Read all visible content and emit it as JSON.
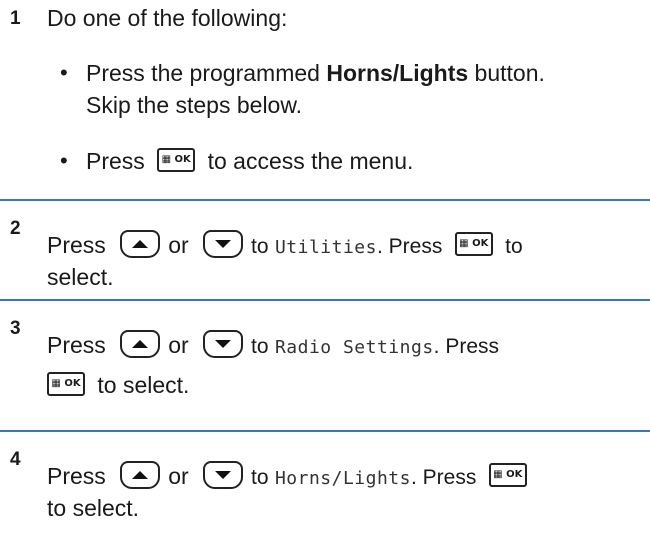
{
  "steps": [
    {
      "number": "1",
      "intro": "Do one of the following:",
      "bullets": [
        {
          "line1_pre": "Press the programmed ",
          "line1_bold": "Horns/Lights",
          "line1_post": " button.",
          "line2": "Skip the steps below."
        },
        {
          "pre": "Press",
          "key": "OK",
          "post": "to access the menu."
        }
      ]
    },
    {
      "number": "2",
      "pre": "Press",
      "or": "or",
      "to": "to",
      "target": "Utilities",
      "press_after": ". Press",
      "key": "OK",
      "end_same_line": "to",
      "line2": "select."
    },
    {
      "number": "3",
      "pre": "Press",
      "or": "or",
      "to": "to",
      "target": "Radio Settings",
      "press_after": ". Press",
      "key": "OK",
      "line2_post": "to select."
    },
    {
      "number": "4",
      "pre": "Press",
      "or": "or",
      "to": "to",
      "target": "Horns/Lights",
      "press_after": ". Press",
      "key": "OK",
      "line2": "to select."
    }
  ],
  "icons": {
    "up": "up-arrow-key-icon",
    "down": "down-arrow-key-icon",
    "ok": "menu-ok-key-icon"
  },
  "colors": {
    "separator": "#3a78b5",
    "text": "#1a1a1a"
  }
}
